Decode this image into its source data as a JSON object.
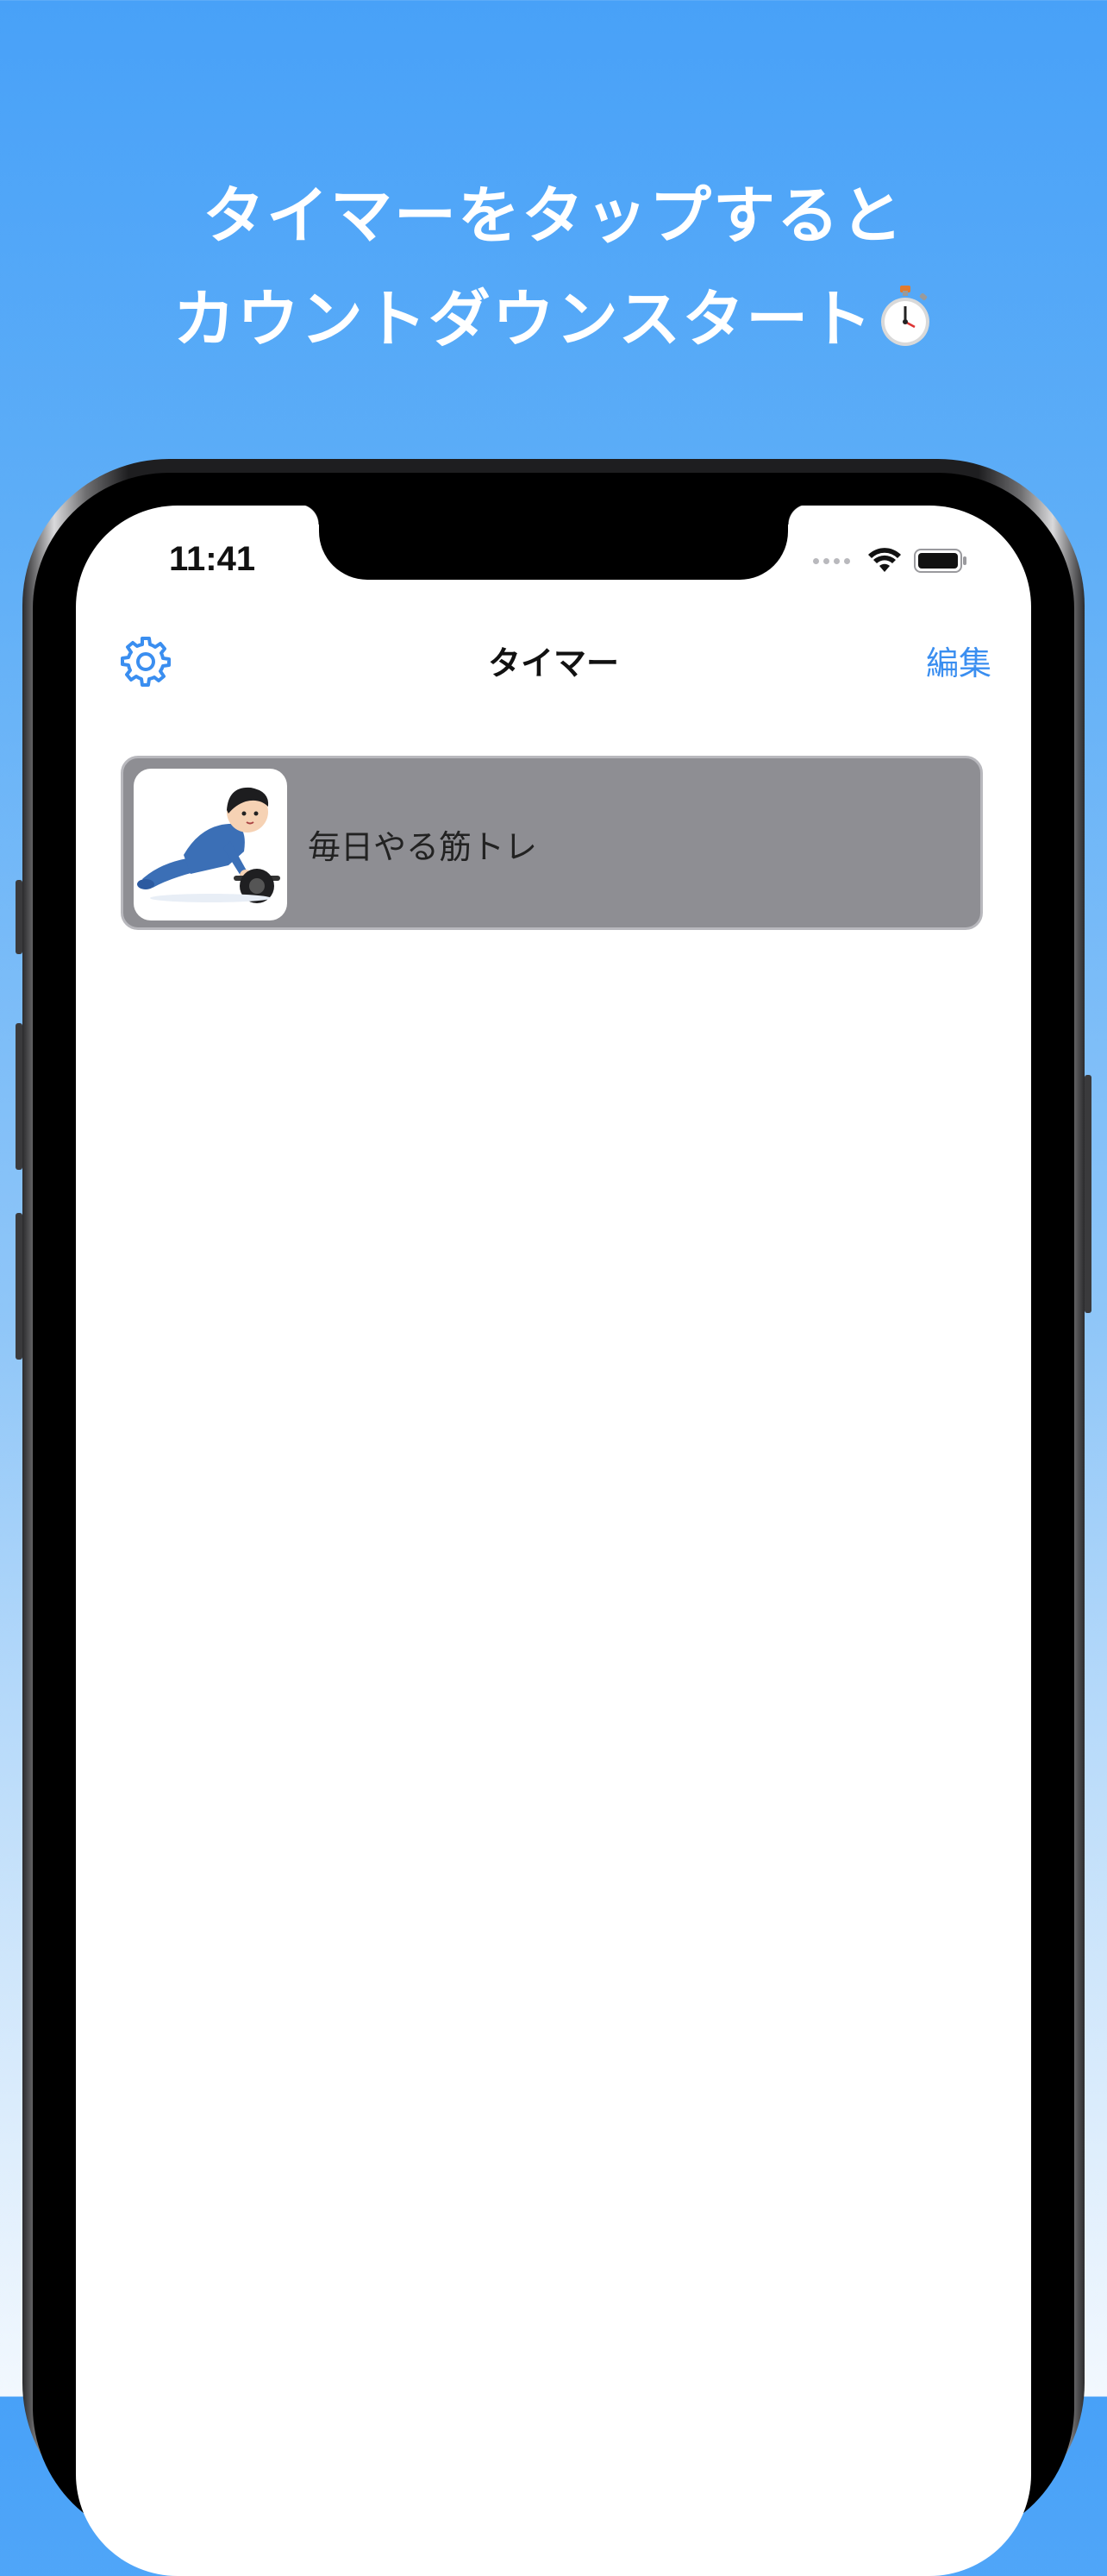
{
  "promo": {
    "line1": "タイマーをタップすると",
    "line2": "カウントダウンスタート",
    "emoji_icon": "stopwatch-icon"
  },
  "status_bar": {
    "time": "11:41",
    "icons": [
      "signal-icon",
      "wifi-icon",
      "battery-icon"
    ]
  },
  "nav": {
    "settings_icon": "gear-icon",
    "title": "タイマー",
    "edit_label": "編集"
  },
  "timers": [
    {
      "name": "毎日やる筋トレ",
      "thumbnail_icon": "ab-roller-workout-illustration"
    }
  ],
  "colors": {
    "accent": "#3a8ef0",
    "card_bg": "#8e8e93",
    "bg_top": "#48a1f8",
    "bg_bottom": "#f2f8fe"
  }
}
